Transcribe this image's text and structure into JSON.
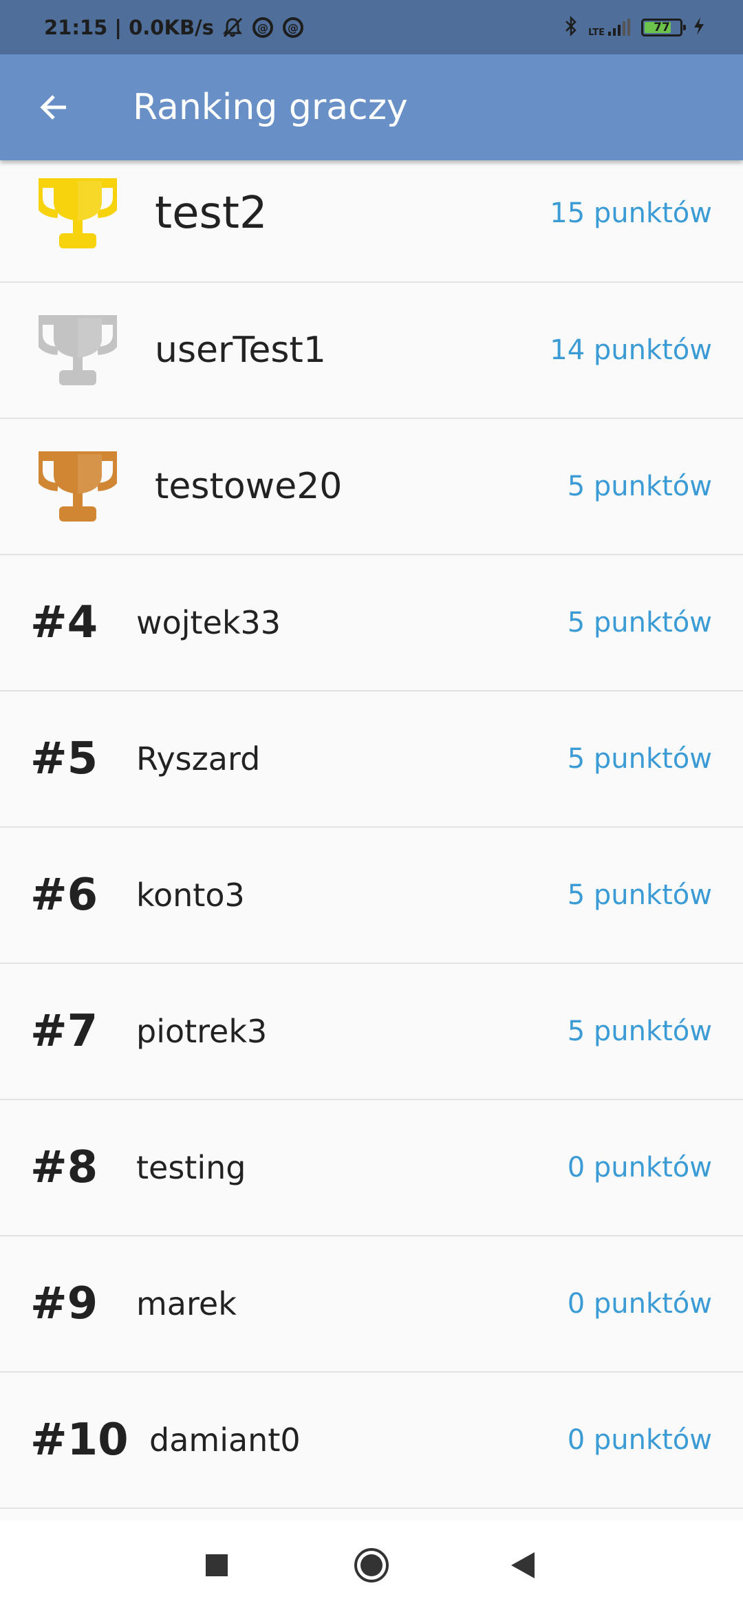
{
  "status_bar": {
    "time_speed": "21:15 | 0.0KB/s",
    "network": "LTE",
    "battery": "77",
    "battery_level": 0.77
  },
  "app_bar": {
    "title": "Ranking graczy"
  },
  "colors": {
    "gold": "#f6d30c",
    "silver": "#c3c3c3",
    "bronze": "#d08632",
    "points": "#3a9bd5",
    "app_bar": "#6890c6"
  },
  "podium": [
    {
      "trophy": "gold-trophy-icon",
      "name": "test2",
      "points": "15 punktów"
    },
    {
      "trophy": "silver-trophy-icon",
      "name": "userTest1",
      "points": "14 punktów"
    },
    {
      "trophy": "bronze-trophy-icon",
      "name": "testowe20",
      "points": "5 punktów"
    }
  ],
  "ranking": [
    {
      "rank": "#4",
      "name": "wojtek33",
      "points": "5 punktów"
    },
    {
      "rank": "#5",
      "name": "Ryszard",
      "points": "5 punktów"
    },
    {
      "rank": "#6",
      "name": "konto3",
      "points": "5 punktów"
    },
    {
      "rank": "#7",
      "name": "piotrek3",
      "points": "5 punktów"
    },
    {
      "rank": "#8",
      "name": "testing",
      "points": "0 punktów"
    },
    {
      "rank": "#9",
      "name": "marek",
      "points": "0 punktów"
    },
    {
      "rank": "#10",
      "name": "damiant0",
      "points": "0 punktów"
    }
  ]
}
